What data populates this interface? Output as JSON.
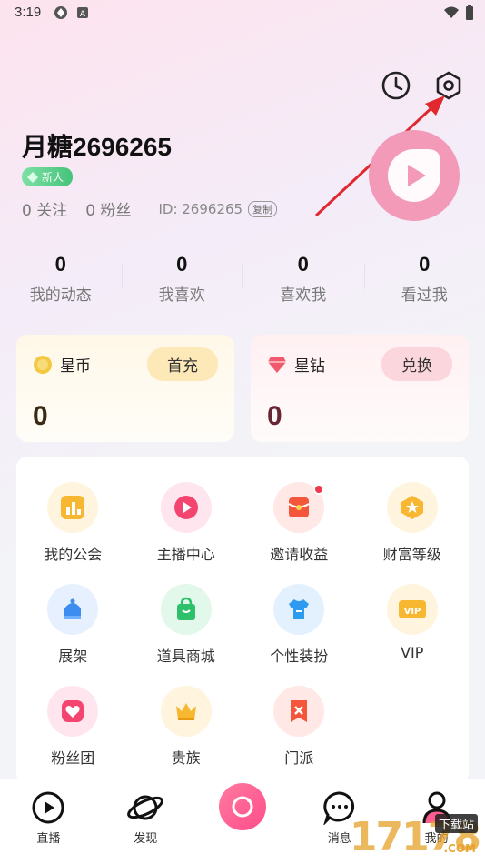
{
  "status": {
    "time": "3:19"
  },
  "profile": {
    "username": "月糖2696265",
    "badge": "新人",
    "follow_label": "0 关注",
    "fans_label": "0 粉丝",
    "uid": "ID: 2696265",
    "copy_label": "复制"
  },
  "stats": [
    {
      "num": "0",
      "label": "我的动态"
    },
    {
      "num": "0",
      "label": "我喜欢"
    },
    {
      "num": "0",
      "label": "喜欢我"
    },
    {
      "num": "0",
      "label": "看过我"
    }
  ],
  "wallet": {
    "coin": {
      "name": "星币",
      "action": "首充",
      "value": "0"
    },
    "diamond": {
      "name": "星钻",
      "action": "兑换",
      "value": "0"
    }
  },
  "menu": [
    {
      "label": "我的公会",
      "icon": "guild-icon"
    },
    {
      "label": "主播中心",
      "icon": "anchor-center-icon"
    },
    {
      "label": "邀请收益",
      "icon": "invite-income-icon"
    },
    {
      "label": "财富等级",
      "icon": "wealth-level-icon"
    },
    {
      "label": "展架",
      "icon": "display-rack-icon"
    },
    {
      "label": "道具商城",
      "icon": "props-mall-icon"
    },
    {
      "label": "个性装扮",
      "icon": "dress-up-icon"
    },
    {
      "label": "VIP",
      "icon": "vip-icon"
    },
    {
      "label": "粉丝团",
      "icon": "fan-club-icon"
    },
    {
      "label": "贵族",
      "icon": "noble-icon"
    },
    {
      "label": "门派",
      "icon": "sect-icon"
    }
  ],
  "tabs": [
    {
      "label": "直播"
    },
    {
      "label": "发现"
    },
    {
      "label": ""
    },
    {
      "label": "消息"
    },
    {
      "label": "我的"
    }
  ],
  "watermark": {
    "main": "17178",
    "tag": "下载站",
    "suffix": ".COM"
  },
  "colors": {
    "accent": "#ff4d8a",
    "logo": "#f39ab9",
    "badge": "#45c37a"
  }
}
